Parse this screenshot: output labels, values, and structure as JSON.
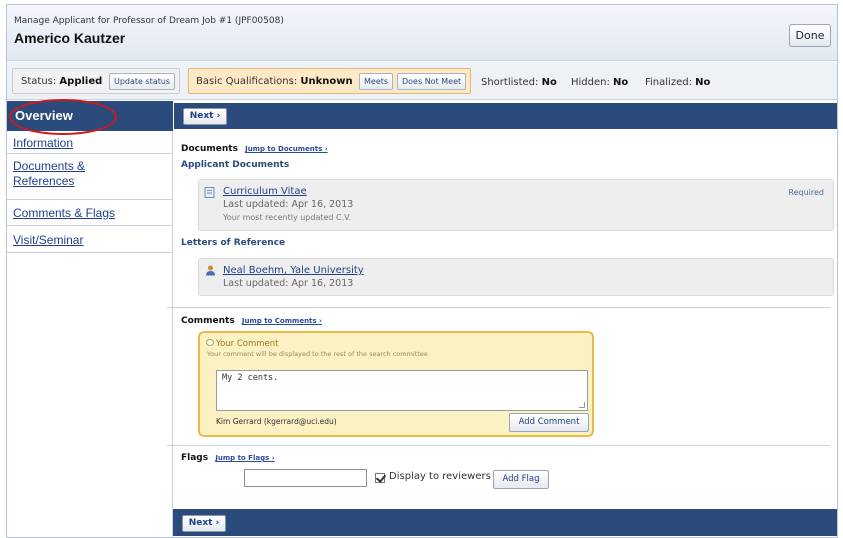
{
  "header": {
    "subtitle": "Manage Applicant for Professor of Dream Job #1 (JPF00508)",
    "title": "Americo Kautzer",
    "done_label": "Done"
  },
  "statusbar": {
    "status_label": "Status:",
    "status_value": "Applied",
    "update_status_label": "Update status",
    "qual_label": "Basic Qualifications:",
    "qual_value": "Unknown",
    "meets_label": "Meets",
    "not_meet_label": "Does Not Meet",
    "shortlisted_label": "Shortlisted:",
    "shortlisted_value": "No",
    "hidden_label": "Hidden:",
    "hidden_value": "No",
    "finalized_label": "Finalized:",
    "finalized_value": "No"
  },
  "sidebar": {
    "active": "Overview",
    "items": [
      {
        "label": "Information"
      },
      {
        "label": "Documents & References"
      },
      {
        "label": "Comments & Flags"
      },
      {
        "label": "Visit/Seminar"
      }
    ]
  },
  "nav": {
    "next_label": "Next ›"
  },
  "documents": {
    "heading": "Documents",
    "jump": "Jump to Documents ›",
    "applicant_heading": "Applicant Documents",
    "cv": {
      "name": "Curriculum Vitae",
      "updated": "Last updated: Apr 16, 2013",
      "note": "Your most recently updated C.V.",
      "badge": "Required"
    },
    "letters_heading": "Letters of Reference",
    "letter": {
      "name": "Neal Boehm, Yale University",
      "updated": "Last updated: Apr 16, 2013"
    }
  },
  "comments": {
    "heading": "Comments",
    "jump": "Jump to Comments ›",
    "box_title": "Your Comment",
    "box_sub": "Your comment will be displayed to the rest of the search committee",
    "text": "My 2 cents.",
    "commenter": "Kim Gerrard (kgerrard@uci.edu)",
    "add_label": "Add Comment"
  },
  "flags": {
    "heading": "Flags",
    "jump": "Jump to Flags ›",
    "input_value": "",
    "display_label": "Display to reviewers",
    "display_checked": true,
    "add_label": "Add Flag"
  },
  "icons": {
    "document": "document-icon",
    "person": "person-icon",
    "comment": "comment-bubble-icon"
  },
  "colors": {
    "nav_bar": "#2a4b7c",
    "link": "#1f3f8a",
    "highlight_circle": "#d01a1a",
    "qual_box": "#fde9c6",
    "comment_box": "#fbf1c3"
  }
}
